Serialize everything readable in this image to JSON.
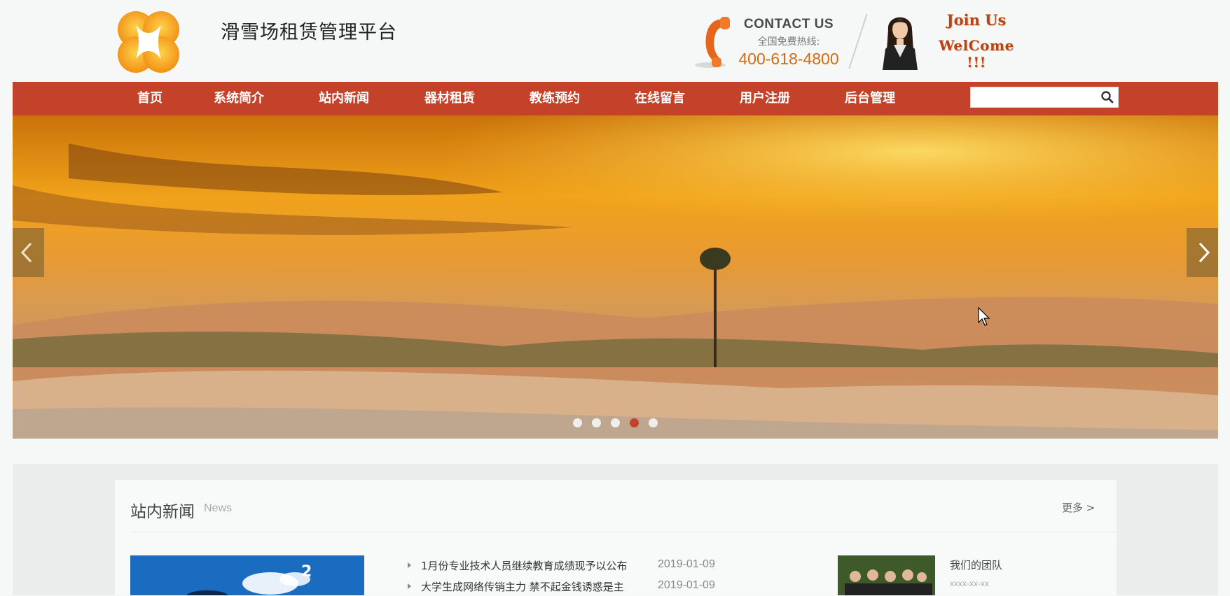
{
  "header": {
    "site_title": "滑雪场租赁管理平台",
    "contact_title": "CONTACT US",
    "contact_sub": "全国免费热线:",
    "contact_phone": "400-618-4800",
    "join_title": "Join Us",
    "welcome": "WelCome !!!"
  },
  "nav": {
    "items": [
      "首页",
      "系统简介",
      "站内新闻",
      "器材租赁",
      "教练预约",
      "在线留言",
      "用户注册",
      "后台管理"
    ]
  },
  "search": {
    "placeholder": "",
    "value": ""
  },
  "banner": {
    "slide_count": 5,
    "active_slide": 4
  },
  "news_section": {
    "title": "站内新闻",
    "subtitle": "News",
    "more": "更多 >",
    "items": [
      {
        "title": "1月份专业技术人员继续教育成绩现予以公布",
        "date": "2019-01-09"
      },
      {
        "title": "大学生成网络传销主力 禁不起金钱诱惑是主",
        "date": "2019-01-09"
      }
    ],
    "team": {
      "title": "我们的团队",
      "date": "xxxx-xx-xx"
    }
  },
  "colors": {
    "accent": "#c4412a",
    "phone_orange": "#d46a12",
    "join_red": "#b8431a"
  }
}
